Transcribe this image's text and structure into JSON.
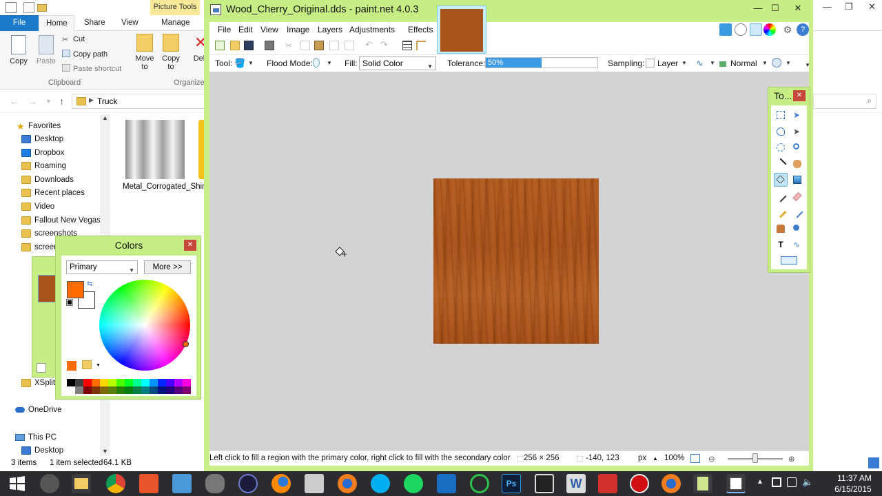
{
  "explorer": {
    "picture_tools": "Picture Tools",
    "tabs": [
      "File",
      "Home",
      "Share",
      "View",
      "Manage"
    ],
    "ribbon": {
      "copy": "Copy",
      "paste": "Paste",
      "cut": "Cut",
      "copy_path": "Copy path",
      "paste_shortcut": "Paste shortcut",
      "move_to": "Move to",
      "copy_to": "Copy to",
      "delete_partial": "Del",
      "group_clipboard": "Clipboard",
      "group_organize": "Organize"
    },
    "address": {
      "path": "Truck"
    },
    "nav": {
      "favorites": "Favorites",
      "items": [
        "Desktop",
        "Dropbox",
        "Roaming",
        "Downloads",
        "Recent places",
        "Video",
        "Fallout New Vegas",
        "screenshots",
        "screen"
      ],
      "xsplit": "XSplit",
      "onedrive": "OneDrive",
      "this_pc": "This PC",
      "this_pc_desktop": "Desktop"
    },
    "files": [
      {
        "name": "Metal_Corrogated_Shiny"
      }
    ],
    "status": {
      "items": "3 items",
      "selected": "1 item selected",
      "size": "64.1 KB"
    }
  },
  "paintnet": {
    "title": "Wood_Cherry_Original.dds - paint.net 4.0.3",
    "menu": [
      "File",
      "Edit",
      "View",
      "Image",
      "Layers",
      "Adjustments",
      "Effects"
    ],
    "toolbar": {
      "tool_label": "Tool:",
      "flood_mode_label": "Flood Mode:",
      "fill_label": "Fill:",
      "fill_value": "Solid Color",
      "tolerance_label": "Tolerance:",
      "tolerance_value": "50%",
      "tolerance_fraction": 0.5,
      "sampling_label": "Sampling:",
      "sampling_value": "Layer",
      "blend_value": "Normal"
    },
    "status": {
      "hint": "Left click to fill a region with the primary color, right click to fill with the secondary color",
      "image_size": "256 × 256",
      "cursor_pos": "-140, 123",
      "units": "px",
      "zoom": "100%"
    },
    "tools_panel": {
      "title": "To..."
    },
    "colors_panel": {
      "title": "Colors",
      "select_value": "Primary",
      "more_button": "More >>",
      "primary_color": "#ff6a00",
      "secondary_color": "#ffffff"
    },
    "accent_color": "#c7ee85"
  },
  "taskbar": {
    "time": "11:37 AM",
    "date": "6/15/2015"
  }
}
